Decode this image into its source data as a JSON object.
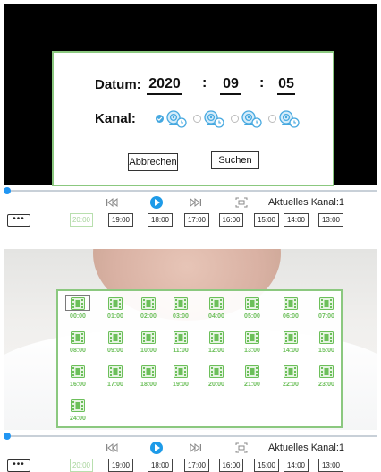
{
  "search_dialog": {
    "date_label": "Datum:",
    "year": "2020",
    "sep1": ":",
    "month": "09",
    "sep2": ":",
    "day": "05",
    "channel_label": "Kanal:",
    "channels": [
      {
        "checked": true
      },
      {
        "checked": false
      },
      {
        "checked": false
      },
      {
        "checked": false
      }
    ],
    "cancel_label": "Abbrechen",
    "search_label": "Suchen"
  },
  "playback_bar": {
    "current_channel": "Aktuelles Kanal:1",
    "more_label": "•••",
    "times": [
      "20:00",
      "19:00",
      "18:00",
      "17:00",
      "16:00",
      "15:00",
      "14:00",
      "13:00"
    ],
    "active_time": "20:00"
  },
  "hour_grid": {
    "hours": [
      "00:00",
      "01:00",
      "02:00",
      "03:00",
      "04:00",
      "05:00",
      "06:00",
      "07:00",
      "08:00",
      "09:00",
      "10:00",
      "11:00",
      "12:00",
      "13:00",
      "14:00",
      "15:00",
      "16:00",
      "17:00",
      "18:00",
      "19:00",
      "20:00",
      "21:00",
      "22:00",
      "23:00",
      "24:00"
    ],
    "selected_hour": "00:00"
  },
  "playback_bar_2": {
    "current_channel": "Aktuelles Kanal:1",
    "more_label": "•••",
    "times": [
      "20:00",
      "19:00",
      "18:00",
      "17:00",
      "16:00",
      "15:00",
      "14:00",
      "13:00"
    ],
    "active_time": "20:00"
  },
  "colors": {
    "accent_green": "#8bc87f",
    "label_green": "#6cbf5a",
    "play_blue": "#1e9be8",
    "icon_blue": "#45a8e0"
  },
  "icons": {
    "channel": "camera-clock-icon",
    "hour": "film-icon",
    "prev": "skip-back-icon",
    "play": "play-icon",
    "next": "skip-forward-icon",
    "screen": "screen-icon"
  }
}
